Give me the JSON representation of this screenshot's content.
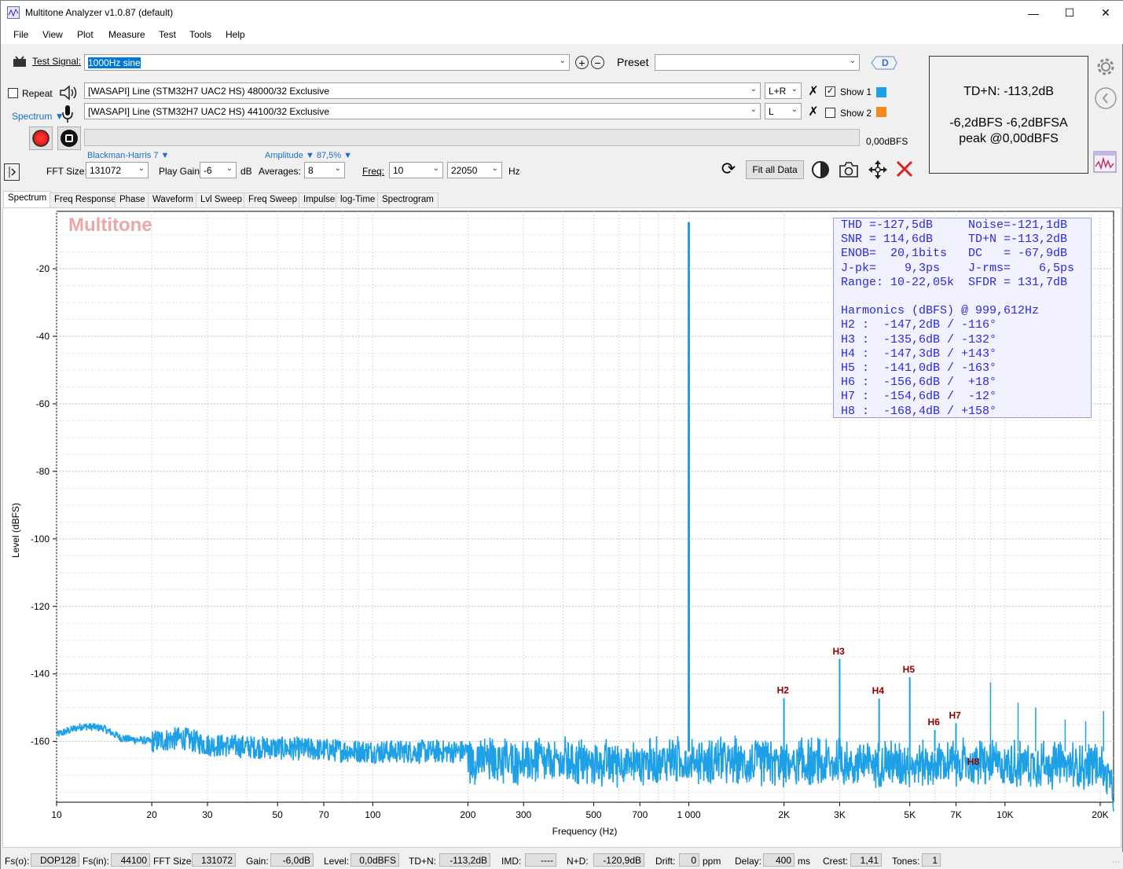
{
  "window": {
    "title": "Multitone Analyzer v1.0.87 (default)"
  },
  "menu": [
    "File",
    "View",
    "Plot",
    "Measure",
    "Test",
    "Tools",
    "Help"
  ],
  "toolbar": {
    "test_signal_label": "Test Signal:",
    "test_signal_value": "1000Hz sine",
    "preset_label": "Preset",
    "preset_value": "",
    "repeat_label": "Repeat",
    "spectrum_label": "Spectrum",
    "output_device": "[WASAPI] Line (STM32H7 UAC2 HS) 48000/32 Exclusive",
    "input_device": "[WASAPI] Line (STM32H7 UAC2 HS) 44100/32 Exclusive",
    "output_channel": "L+R",
    "input_channel": "L",
    "show1_label": "Show 1",
    "show2_label": "Show 2",
    "level_readout": "0,00dBFS",
    "window_func": "Blackman-Harris 7",
    "amplitude_label": "Amplitude",
    "amplitude_value": "87,5%",
    "fft_size_label": "FFT Size:",
    "fft_size_value": "131072",
    "play_gain_label": "Play Gain:",
    "play_gain_value": "-6",
    "play_gain_unit": "dB",
    "averages_label": "Averages:",
    "averages_value": "8",
    "freq_label": "Freq:",
    "freq_min": "10",
    "freq_max": "22050",
    "freq_unit": "Hz",
    "fit_all_label": "Fit all Data",
    "show1_color": "#1ea0e6",
    "show2_color": "#f28a1e"
  },
  "summary": {
    "tdn": "TD+N: -113,2dB",
    "levels": "-6,2dBFS  -6,2dBFSA",
    "peak": "peak @0,00dBFS"
  },
  "tabs": [
    "Spectrum",
    "Freq Response",
    "Phase",
    "Waveform",
    "Lvl Sweep",
    "Freq Sweep",
    "Impulse",
    "log-Time",
    "Spectrogram"
  ],
  "plot": {
    "watermark": "Multitone",
    "ylabel": "Level (dBFS)",
    "xlabel": "Frequency (Hz)",
    "stats": [
      "THD =-127,5dB     Noise=-121,1dB",
      "SNR = 114,6dB     TD+N =-113,2dB",
      "ENOB=  20,1bits   DC   = -67,9dB",
      "J-pk=    9,3ps    J-rms=    6,5ps",
      "Range: 10-22,05k  SFDR = 131,7dB",
      "",
      "Harmonics (dBFS) @ 999,612Hz",
      "H2 :  -147,2dB / -116°",
      "H3 :  -135,6dB / -132°",
      "H4 :  -147,3dB / +143°",
      "H5 :  -141,0dB / -163°",
      "H6 :  -156,6dB /  +18°",
      "H7 :  -154,6dB /  -12°",
      "H8 :  -168,4dB / +158°"
    ]
  },
  "chart_data": {
    "type": "line",
    "xlabel": "Frequency (Hz)",
    "ylabel": "Level (dBFS)",
    "xscale": "log",
    "xlim": [
      10,
      22050
    ],
    "ylim": [
      -178,
      -3
    ],
    "grid": true,
    "x_ticks": [
      {
        "v": 10,
        "label": "10"
      },
      {
        "v": 20,
        "label": "20"
      },
      {
        "v": 30,
        "label": "30"
      },
      {
        "v": 50,
        "label": "50"
      },
      {
        "v": 70,
        "label": "70"
      },
      {
        "v": 100,
        "label": "100"
      },
      {
        "v": 200,
        "label": "200"
      },
      {
        "v": 300,
        "label": "300"
      },
      {
        "v": 500,
        "label": "500"
      },
      {
        "v": 700,
        "label": "700"
      },
      {
        "v": 1000,
        "label": "1 000"
      },
      {
        "v": 2000,
        "label": "2K"
      },
      {
        "v": 3000,
        "label": "3K"
      },
      {
        "v": 5000,
        "label": "5K"
      },
      {
        "v": 7000,
        "label": "7K"
      },
      {
        "v": 10000,
        "label": "10K"
      },
      {
        "v": 20000,
        "label": "20K"
      }
    ],
    "y_ticks": [
      -20,
      -40,
      -60,
      -80,
      -100,
      -120,
      -140,
      -160
    ],
    "noise_floor": [
      [
        10,
        -158
      ],
      [
        12,
        -155.5
      ],
      [
        14,
        -156
      ],
      [
        16,
        -159
      ],
      [
        20,
        -160
      ],
      [
        25,
        -159
      ],
      [
        30,
        -161
      ],
      [
        50,
        -162
      ],
      [
        100,
        -163
      ],
      [
        200,
        -163
      ],
      [
        500,
        -164
      ],
      [
        1000,
        -163
      ],
      [
        2000,
        -164
      ],
      [
        5000,
        -164
      ],
      [
        10000,
        -164
      ],
      [
        20000,
        -165
      ],
      [
        22050,
        -172
      ]
    ],
    "fundamental": {
      "x": 999.612,
      "y": -6.2
    },
    "harmonics": [
      {
        "name": "H2",
        "x": 1999,
        "y": -147.2
      },
      {
        "name": "H3",
        "x": 2999,
        "y": -135.6
      },
      {
        "name": "H4",
        "x": 3998,
        "y": -147.3
      },
      {
        "name": "H5",
        "x": 4998,
        "y": -141.0
      },
      {
        "name": "H6",
        "x": 5998,
        "y": -156.6
      },
      {
        "name": "H7",
        "x": 6997,
        "y": -154.6
      },
      {
        "name": "H8",
        "x": 7997,
        "y": -168.4
      }
    ],
    "spurs": [
      {
        "x": 9000,
        "y": -142.5
      },
      {
        "x": 11000,
        "y": -148.5
      },
      {
        "x": 12500,
        "y": -150
      },
      {
        "x": 15500,
        "y": -153.5
      },
      {
        "x": 18000,
        "y": -154
      },
      {
        "x": 20500,
        "y": -151
      }
    ],
    "series_color": "#1ea0e6"
  },
  "status": {
    "fs_out_label": "Fs(o):",
    "fs_out": "DOP128",
    "fs_in_label": "Fs(in):",
    "fs_in": "44100",
    "fft_label": "FFT Size:",
    "fft": "131072",
    "gain_label": "Gain:",
    "gain": "-6,0dB",
    "level_label": "Level:",
    "level": "0,0dBFS",
    "tdn_label": "TD+N:",
    "tdn": "-113,2dB",
    "imd_label": "IMD:",
    "imd": "----",
    "nd_label": "N+D:",
    "nd": "-120,9dB",
    "drift_label": "Drift:",
    "drift": "0",
    "drift_unit": "ppm",
    "delay_label": "Delay:",
    "delay": "400",
    "delay_unit": "ms",
    "crest_label": "Crest:",
    "crest": "1,41",
    "tones_label": "Tones:",
    "tones": "1"
  }
}
